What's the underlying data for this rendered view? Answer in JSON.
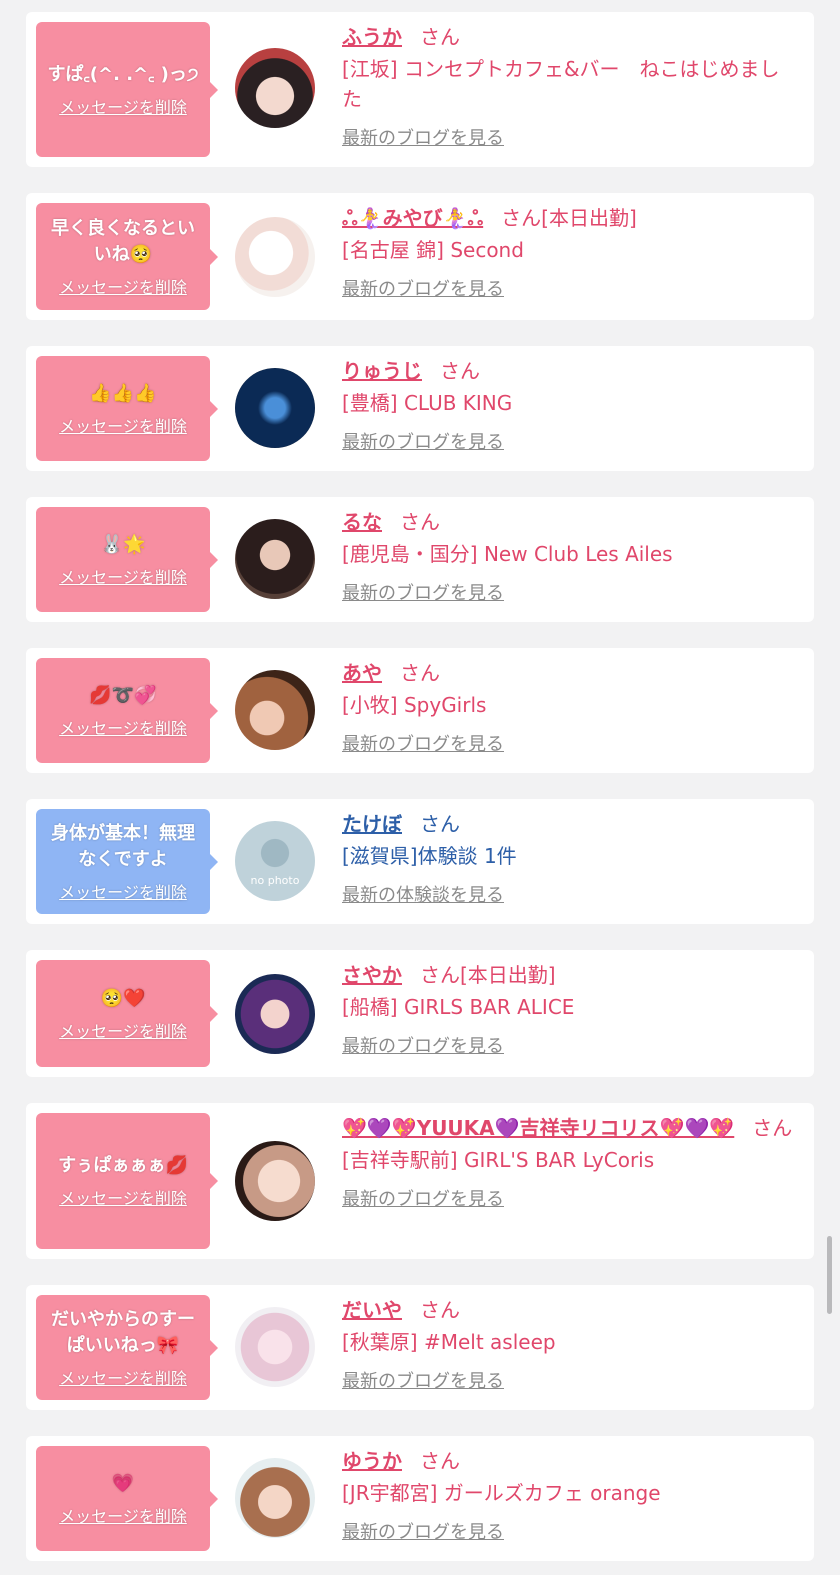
{
  "delete_label": "メッセージを削除",
  "san_label": "さん",
  "colors": {
    "pink_bubble": "#f78ea1",
    "blue_bubble": "#8fb5f4",
    "name_pink": "#e0476b",
    "name_blue": "#2d5fa8"
  },
  "items": [
    {
      "message": "すぱ꜀(^. .^꜀ )っ੭",
      "name": "ふうか",
      "tag": "",
      "shop": "[江坂] コンセプトカフェ&バー　ねこはじめました",
      "link": "最新のブログを見る"
    },
    {
      "message": "早く良くなるといいね🥺",
      "name": "ஃ🧜‍♀️みやび🧜‍♀️ஃ",
      "tag": "[本日出勤]",
      "shop": "[名古屋 錦] Second",
      "link": "最新のブログを見る"
    },
    {
      "message": "👍👍👍",
      "name": "りゅうじ",
      "tag": "",
      "shop": "[豊橋] CLUB KING",
      "link": "最新のブログを見る"
    },
    {
      "message": "🐰🌟",
      "name": "るな",
      "tag": "",
      "shop": "[鹿児島・国分] New Club Les Ailes",
      "link": "最新のブログを見る"
    },
    {
      "message": "💋➰💞",
      "name": "あや",
      "tag": "",
      "shop": "[小牧] SpyGirls",
      "link": "最新のブログを見る"
    },
    {
      "message": "身体が基本！無理なくですよ",
      "name": "たけぼ",
      "tag": "",
      "shop": "[滋賀県]体験談 1件",
      "link": "最新の体験談を見る",
      "avatar_text": "no photo"
    },
    {
      "message": "🥺❤️",
      "name": "さやか",
      "tag": "[本日出勤]",
      "shop": "[船橋] GIRLS BAR ALICE",
      "link": "最新のブログを見る"
    },
    {
      "message": "すぅぱぁぁぁ💋",
      "name": "💖💜💖YUUKA💜吉祥寺リコリス💖💜💖",
      "tag": "",
      "shop": "[吉祥寺駅前] GIRL'S BAR LyCoris",
      "link": "最新のブログを見る"
    },
    {
      "message": "だいやからのすーぱいいねっ🎀",
      "name": "だいや",
      "tag": "",
      "shop": "[秋葉原] #Melt asleep",
      "link": "最新のブログを見る"
    },
    {
      "message": "💗",
      "name": "ゆうか",
      "tag": "",
      "shop": "[JR宇都宮] ガールズカフェ orange",
      "link": "最新のブログを見る"
    }
  ]
}
